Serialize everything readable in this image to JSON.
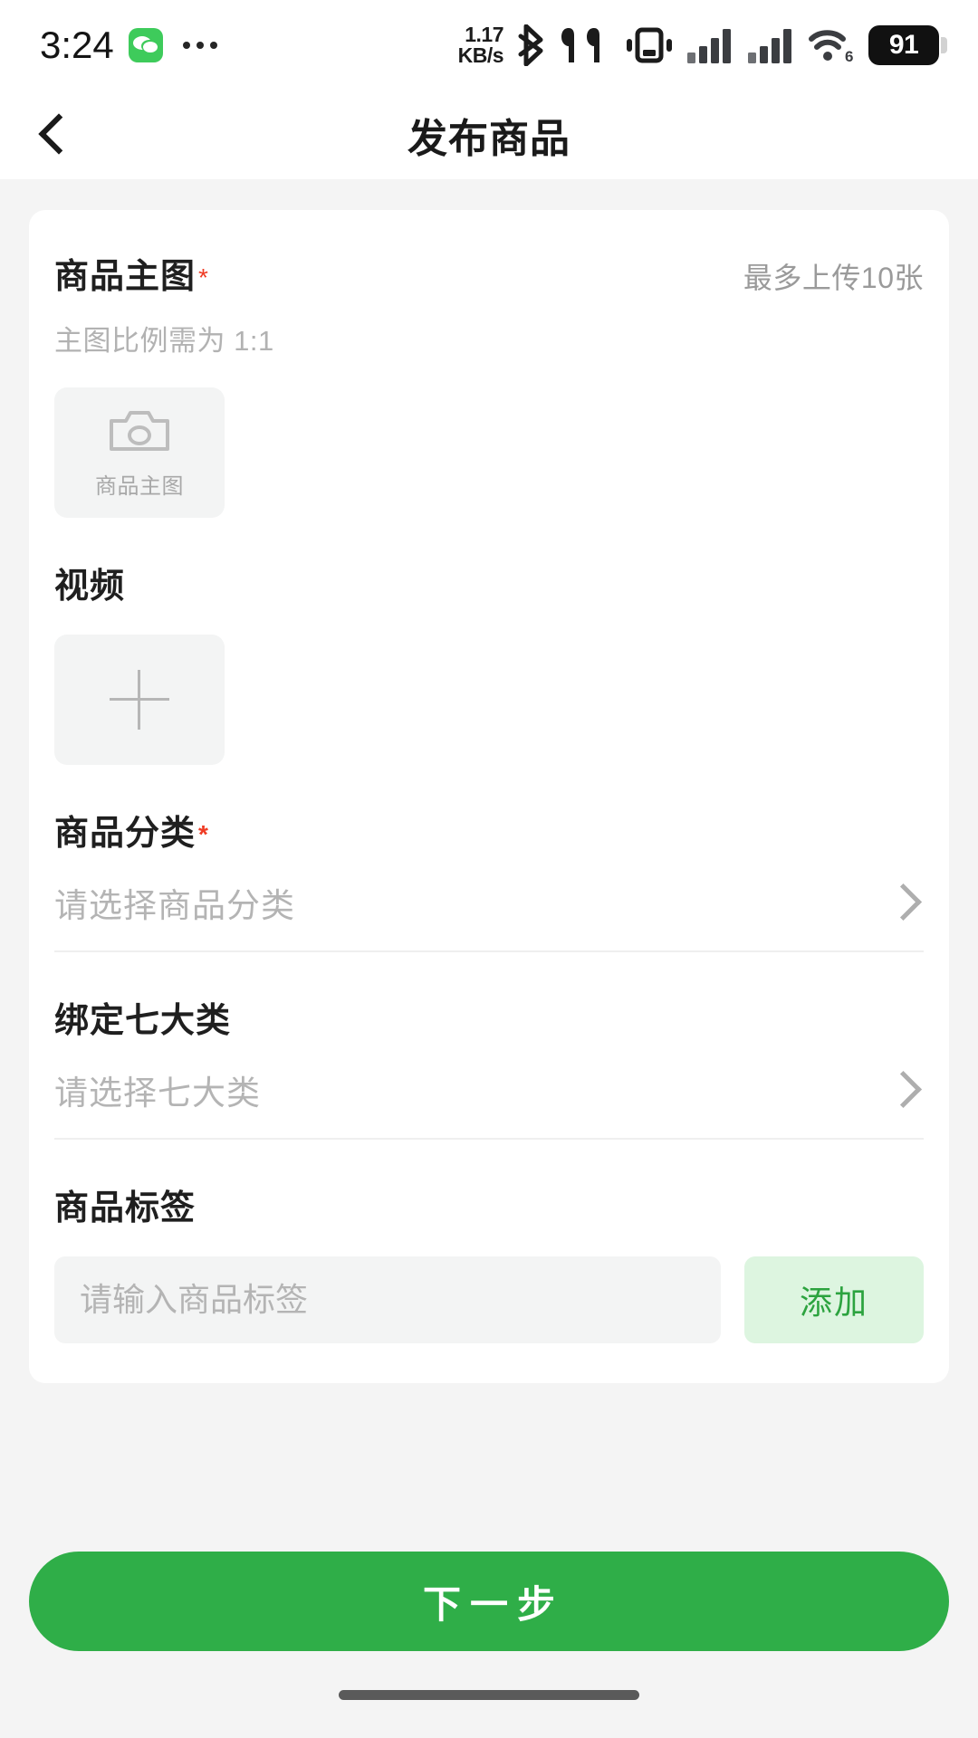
{
  "status_bar": {
    "time": "3:24",
    "app_icon": "wechat-icon",
    "overflow_indicator": "...",
    "net_speed_value": "1.17",
    "net_speed_unit": "KB/s",
    "icons": [
      "bluetooth-icon",
      "earbuds-icon",
      "vibrate-mode-icon",
      "signal-bars-sim1-icon",
      "signal-bars-sim2-icon",
      "wifi-6-icon"
    ],
    "wifi_generation": "6",
    "battery_percent": "91"
  },
  "navbar": {
    "back_icon": "chevron-left-icon",
    "title": "发布商品"
  },
  "main_image": {
    "label": "商品主图",
    "required_mark": "*",
    "max_hint": "最多上传10张",
    "ratio_hint": "主图比例需为 1:1",
    "uploader_label": "商品主图",
    "uploader_icon": "camera-icon"
  },
  "video": {
    "label": "视频",
    "uploader_icon": "plus-icon"
  },
  "category": {
    "label": "商品分类",
    "required_mark": "*",
    "placeholder": "请选择商品分类",
    "chevron": "chevron-right-icon"
  },
  "seven_types": {
    "label": "绑定七大类",
    "placeholder": "请选择七大类",
    "chevron": "chevron-right-icon"
  },
  "tags": {
    "label": "商品标签",
    "input_placeholder": "请输入商品标签",
    "input_value": "",
    "add_label": "添加"
  },
  "footer": {
    "next_label": "下一步"
  },
  "colors": {
    "brand_green": "#2fae48",
    "add_button_bg": "#ddf5e0",
    "add_button_text": "#2ca33f",
    "required_red": "#ef3b24",
    "page_bg": "#f4f4f4",
    "card_bg": "#ffffff",
    "placeholder_gray": "#b4b4b4",
    "battery_fill": "#111111"
  }
}
